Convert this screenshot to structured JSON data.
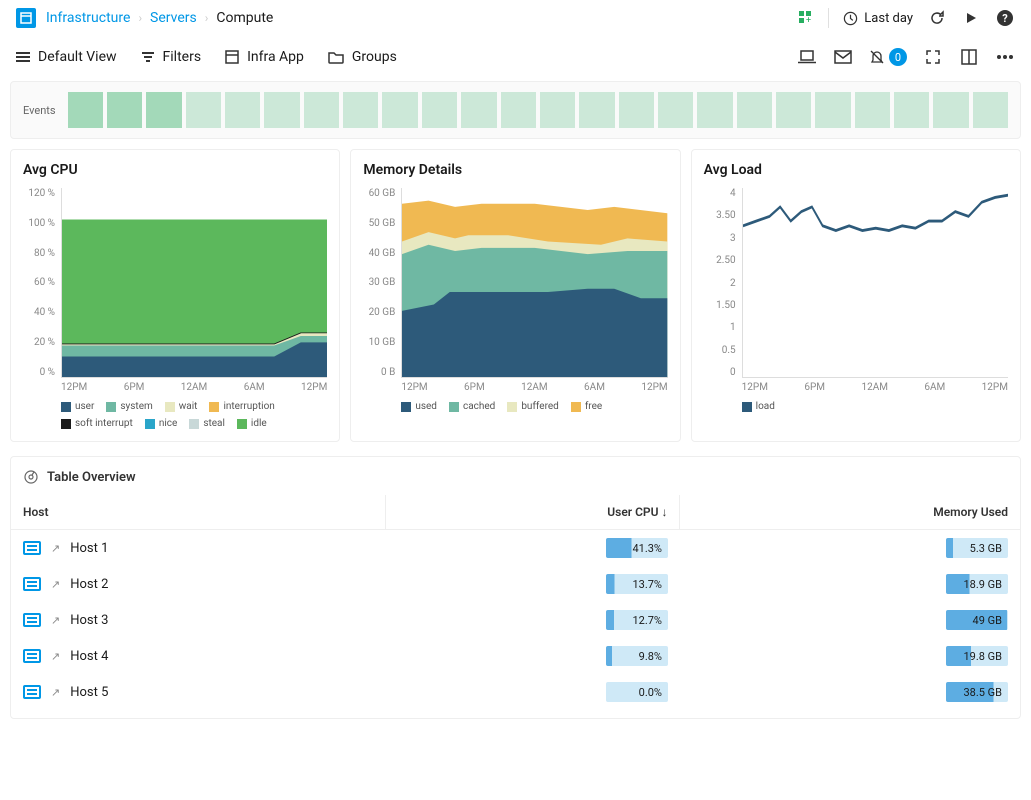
{
  "breadcrumb": {
    "root": "Infrastructure",
    "mid": "Servers",
    "current": "Compute"
  },
  "time_range": "Last day",
  "toolbar": {
    "default_view": "Default View",
    "filters": "Filters",
    "infra_app": "Infra App",
    "groups": "Groups",
    "alerts_count": "0"
  },
  "events": {
    "label": "Events"
  },
  "charts": {
    "cpu": {
      "title": "Avg CPU"
    },
    "memory": {
      "title": "Memory Details"
    },
    "load": {
      "title": "Avg Load"
    }
  },
  "x_labels": [
    "12PM",
    "6PM",
    "12AM",
    "6AM",
    "12PM"
  ],
  "cpu_y": [
    "120 %",
    "100 %",
    "80 %",
    "60 %",
    "40 %",
    "20 %",
    "0 %"
  ],
  "mem_y": [
    "60 GB",
    "50 GB",
    "40 GB",
    "30 GB",
    "20 GB",
    "10 GB",
    "0 B"
  ],
  "load_y": [
    "4",
    "3.50",
    "3",
    "2.50",
    "2",
    "1.50",
    "1",
    "0.5",
    "0"
  ],
  "cpu_legend": [
    {
      "label": "user",
      "color": "#2d5a7a"
    },
    {
      "label": "system",
      "color": "#6fb8a3"
    },
    {
      "label": "wait",
      "color": "#e8e8c0"
    },
    {
      "label": "interruption",
      "color": "#f0b952"
    },
    {
      "label": "soft interrupt",
      "color": "#1a1a1a"
    },
    {
      "label": "nice",
      "color": "#2aa5c9"
    },
    {
      "label": "steal",
      "color": "#c8d8d8"
    },
    {
      "label": "idle",
      "color": "#5cb85c"
    }
  ],
  "mem_legend": [
    {
      "label": "used",
      "color": "#2d5a7a"
    },
    {
      "label": "cached",
      "color": "#6fb8a3"
    },
    {
      "label": "buffered",
      "color": "#e8e8c0"
    },
    {
      "label": "free",
      "color": "#f0b952"
    }
  ],
  "load_legend": [
    {
      "label": "load",
      "color": "#2d5a7a"
    }
  ],
  "table": {
    "title": "Table Overview",
    "columns": {
      "host": "Host",
      "cpu": "User CPU ↓",
      "mem": "Memory Used"
    },
    "rows": [
      {
        "host": "Host 1",
        "cpu": "41.3%",
        "cpu_pct": 41,
        "mem": "5.3 GB",
        "mem_pct": 11
      },
      {
        "host": "Host 2",
        "cpu": "13.7%",
        "cpu_pct": 14,
        "mem": "18.9 GB",
        "mem_pct": 38
      },
      {
        "host": "Host 3",
        "cpu": "12.7%",
        "cpu_pct": 13,
        "mem": "49 GB",
        "mem_pct": 98
      },
      {
        "host": "Host 4",
        "cpu": "9.8%",
        "cpu_pct": 10,
        "mem": "19.8 GB",
        "mem_pct": 40
      },
      {
        "host": "Host 5",
        "cpu": "0.0%",
        "cpu_pct": 0,
        "mem": "38.5 GB",
        "mem_pct": 77
      }
    ]
  },
  "chart_data": [
    {
      "type": "area",
      "title": "Avg CPU",
      "ylabel": "%",
      "ylim": [
        0,
        120
      ],
      "x": [
        "12PM",
        "6PM",
        "12AM",
        "6AM",
        "12PM"
      ],
      "series": [
        {
          "name": "user",
          "values": [
            13,
            13,
            13,
            13,
            22
          ]
        },
        {
          "name": "system",
          "values": [
            8,
            8,
            8,
            8,
            6
          ]
        },
        {
          "name": "wait",
          "values": [
            1,
            1,
            1,
            1,
            1
          ]
        },
        {
          "name": "interruption",
          "values": [
            0,
            0,
            0,
            0,
            0
          ]
        },
        {
          "name": "soft interrupt",
          "values": [
            0,
            0,
            0,
            0,
            0
          ]
        },
        {
          "name": "nice",
          "values": [
            0,
            0,
            0,
            0,
            0
          ]
        },
        {
          "name": "steal",
          "values": [
            0,
            0,
            0,
            0,
            0
          ]
        },
        {
          "name": "idle",
          "values": [
            78,
            78,
            78,
            78,
            71
          ]
        }
      ]
    },
    {
      "type": "area",
      "title": "Memory Details",
      "ylabel": "GB",
      "ylim": [
        0,
        60
      ],
      "x": [
        "12PM",
        "6PM",
        "12AM",
        "6AM",
        "12PM"
      ],
      "series": [
        {
          "name": "used",
          "values": [
            21,
            27,
            27,
            27,
            25
          ]
        },
        {
          "name": "cached",
          "values": [
            18,
            14,
            14,
            13,
            15
          ]
        },
        {
          "name": "buffered",
          "values": [
            4,
            4,
            4,
            4,
            3
          ]
        },
        {
          "name": "free",
          "values": [
            12,
            10,
            10,
            10,
            9
          ]
        }
      ]
    },
    {
      "type": "line",
      "title": "Avg Load",
      "ylabel": "",
      "ylim": [
        0,
        4
      ],
      "x": [
        "12PM",
        "6PM",
        "12AM",
        "6AM",
        "12PM"
      ],
      "series": [
        {
          "name": "load",
          "values": [
            3.2,
            3.5,
            3.1,
            3.1,
            3.9
          ]
        }
      ]
    }
  ]
}
